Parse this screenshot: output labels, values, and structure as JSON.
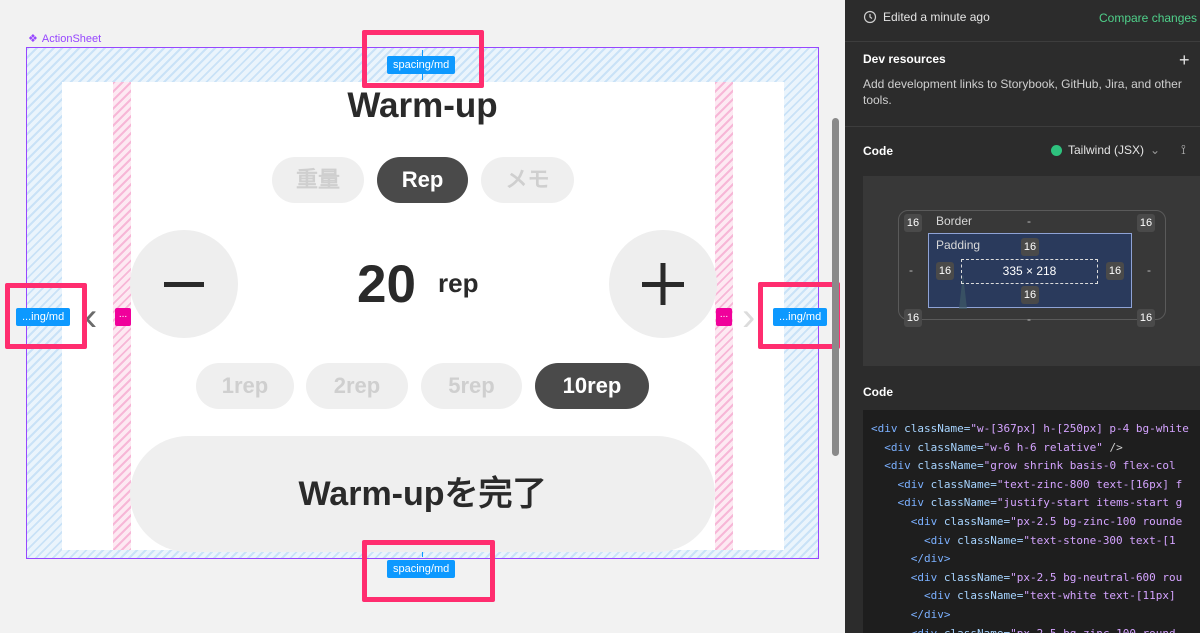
{
  "canvas": {
    "frame_label": "ActionSheet",
    "title": "Warm-up",
    "segments": [
      {
        "label": "重量",
        "active": false
      },
      {
        "label": "Rep",
        "active": true
      },
      {
        "label": "メモ",
        "active": false
      }
    ],
    "minus_label": "−",
    "plus_label": "+",
    "value": "20",
    "unit": "rep",
    "increments": [
      {
        "label": "1rep",
        "active": false
      },
      {
        "label": "2rep",
        "active": false
      },
      {
        "label": "5rep",
        "active": false
      },
      {
        "label": "10rep",
        "active": true
      }
    ],
    "done_button": "Warm-upを完了",
    "spacing_top": "spacing/md",
    "spacing_bottom": "spacing/md",
    "spacing_left": "...ing/md",
    "spacing_right": "...ing/md",
    "ellipsis": "...",
    "chevron_left": "‹",
    "chevron_right": "›",
    "colors": {
      "highlight": "#ff2d6f",
      "spacing": "#0d99ff",
      "selection": "#9747ff"
    }
  },
  "panel": {
    "edited": "Edited a minute ago",
    "compare": "Compare changes",
    "dev_resources": {
      "title": "Dev resources",
      "add": "+",
      "description": "Add development links to Storybook, GitHub, Jira, and other tools."
    },
    "code_header": {
      "title": "Code",
      "language": "Tailwind (JSX)",
      "chevron": "⌄",
      "settings": "⟟"
    },
    "box_model": {
      "border_label": "Border",
      "padding_label": "Padding",
      "border_top": "-",
      "border_bottom": "-",
      "border_left": "-",
      "border_right": "-",
      "corner_tl": "16",
      "corner_tr": "16",
      "corner_bl": "16",
      "corner_br": "16",
      "padding_top": "16",
      "padding_bottom": "16",
      "padding_left": "16",
      "padding_right": "16",
      "content_size": "335 × 218"
    },
    "code_title": "Code",
    "code_lines": [
      {
        "indent": "",
        "tag": "<div ",
        "attr": "className=",
        "str": "\"w-[367px] h-[250px] p-4 bg-white",
        "end": ""
      },
      {
        "indent": "  ",
        "tag": "<div ",
        "attr": "className=",
        "str": "\"w-6 h-6 relative\"",
        "end": " />"
      },
      {
        "indent": "  ",
        "tag": "<div ",
        "attr": "className=",
        "str": "\"grow shrink basis-0 flex-col",
        "end": ""
      },
      {
        "indent": "    ",
        "tag": "<div ",
        "attr": "className=",
        "str": "\"text-zinc-800 text-[16px] f",
        "end": ""
      },
      {
        "indent": "    ",
        "tag": "<div ",
        "attr": "className=",
        "str": "\"justify-start items-start g",
        "end": ""
      },
      {
        "indent": "      ",
        "tag": "<div ",
        "attr": "className=",
        "str": "\"px-2.5 bg-zinc-100 rounde",
        "end": ""
      },
      {
        "indent": "        ",
        "tag": "<div ",
        "attr": "className=",
        "str": "\"text-stone-300 text-[1",
        "end": ""
      },
      {
        "indent": "      ",
        "tag": "</div>",
        "attr": "",
        "str": "",
        "end": ""
      },
      {
        "indent": "      ",
        "tag": "<div ",
        "attr": "className=",
        "str": "\"px-2.5 bg-neutral-600 rou",
        "end": ""
      },
      {
        "indent": "        ",
        "tag": "<div ",
        "attr": "className=",
        "str": "\"text-white text-[11px]",
        "end": ""
      },
      {
        "indent": "      ",
        "tag": "</div>",
        "attr": "",
        "str": "",
        "end": ""
      },
      {
        "indent": "      ",
        "tag": "<div ",
        "attr": "className=",
        "str": "\"px-2.5 bg-zinc-100 round",
        "end": ""
      }
    ]
  }
}
